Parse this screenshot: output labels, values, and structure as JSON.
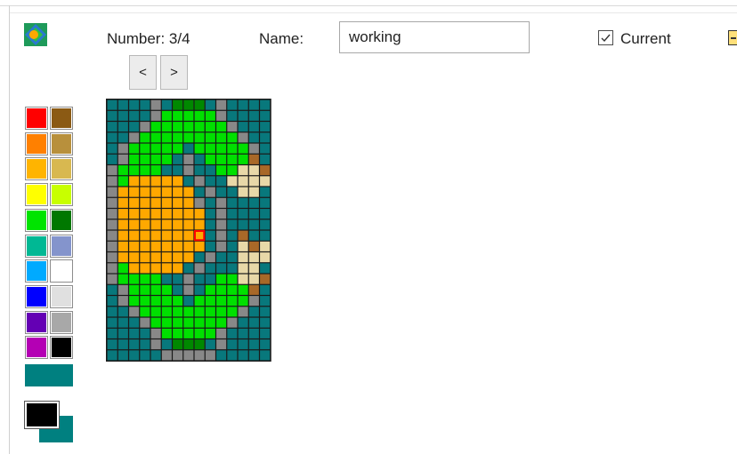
{
  "header": {
    "number_label": "Number: 3/4",
    "name_label": "Name:",
    "name_value": "working",
    "current_label": "Current",
    "current_checked": true
  },
  "nav": {
    "prev_label": "<",
    "next_label": ">"
  },
  "palette": {
    "swatches": [
      [
        "#ff0000",
        "#8b5a14"
      ],
      [
        "#ff8000",
        "#b8903c"
      ],
      [
        "#ffb400",
        "#d8b850"
      ],
      [
        "#ffff00",
        "#c8ff00"
      ],
      [
        "#00e400",
        "#007800"
      ],
      [
        "#00b894",
        "#8494cc"
      ],
      [
        "#00aaff",
        "#ffffff"
      ],
      [
        "#0000ff",
        "#e0e0e0"
      ],
      [
        "#6400b4",
        "#a8a8a8"
      ],
      [
        "#b400b4",
        "#000000"
      ]
    ],
    "wide": "#008080",
    "foreground": "#000000",
    "background": "#008080"
  },
  "sprite": {
    "colors": {
      ".": "#08787c",
      "G": "#00e000",
      "D": "#008800",
      "o": "#ffa800",
      "g": "#888888",
      "c": "#e8d8a8",
      "b": "#a86828"
    },
    "selected_cell": [
      12,
      8
    ],
    "rows": [
      "....g.DDD.g....",
      "....gGGGGGg....",
      "...gGGGGGGGg...",
      "..gGGGGGGGGGg..",
      ".gGGGGG.GGGGGg.",
      ".gGGGG.g.GGGGb.",
      "gGGGG..g..GGccb",
      "gGooooo.g..cccc",
      "gooooooo.g..cc.",
      "gooooooog.g....",
      "goooooooo.g....",
      "goooooooo.g....",
      "goooooooo.g.b..",
      "goooooooo.g.cbc",
      "gooooooo.g..ccc",
      "gGooooo.g...cc.",
      "gGGGG..g..GGccb",
      ".gGGGG.g.GGGGb.",
      ".gGGGGG.GGGGGg.",
      "..gGGGGGGGGGg..",
      "...gGGGGGGGg...",
      "....gGGGGGg....",
      "....g.DDD.g....",
      ".....ggggg....."
    ]
  }
}
